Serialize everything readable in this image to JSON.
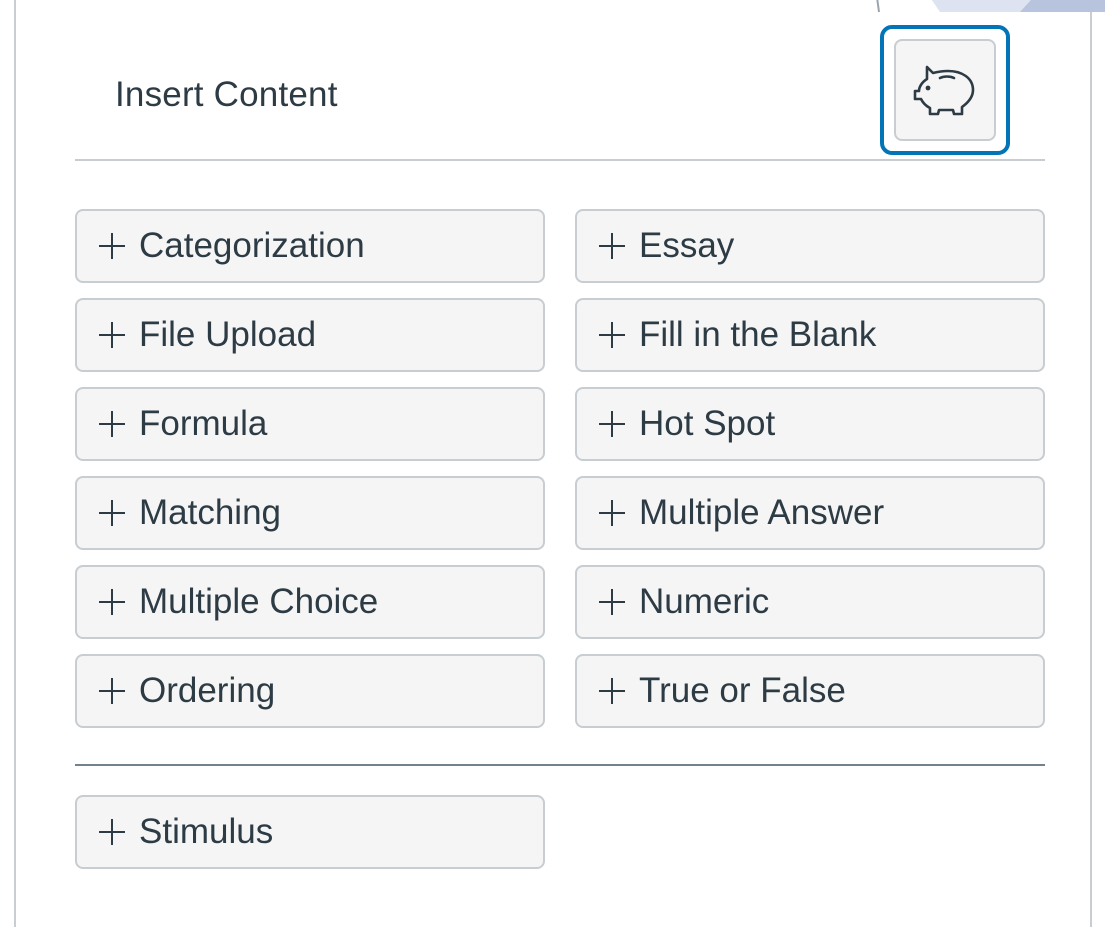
{
  "panel": {
    "title": "Insert Content",
    "item_bank_button": {
      "icon": "piggy-bank-icon"
    }
  },
  "question_types": [
    {
      "label": "Categorization",
      "key": "categorization"
    },
    {
      "label": "Essay",
      "key": "essay"
    },
    {
      "label": "File Upload",
      "key": "file-upload"
    },
    {
      "label": "Fill in the Blank",
      "key": "fill-in-the-blank"
    },
    {
      "label": "Formula",
      "key": "formula"
    },
    {
      "label": "Hot Spot",
      "key": "hot-spot"
    },
    {
      "label": "Matching",
      "key": "matching"
    },
    {
      "label": "Multiple Answer",
      "key": "multiple-answer"
    },
    {
      "label": "Multiple Choice",
      "key": "multiple-choice"
    },
    {
      "label": "Numeric",
      "key": "numeric"
    },
    {
      "label": "Ordering",
      "key": "ordering"
    },
    {
      "label": "True or False",
      "key": "true-or-false"
    }
  ],
  "stimulus": {
    "label": "Stimulus"
  },
  "colors": {
    "focus_ring": "#0374b5",
    "button_bg": "#f5f5f5",
    "button_border": "#c7cdd1",
    "text": "#2d3b45"
  }
}
